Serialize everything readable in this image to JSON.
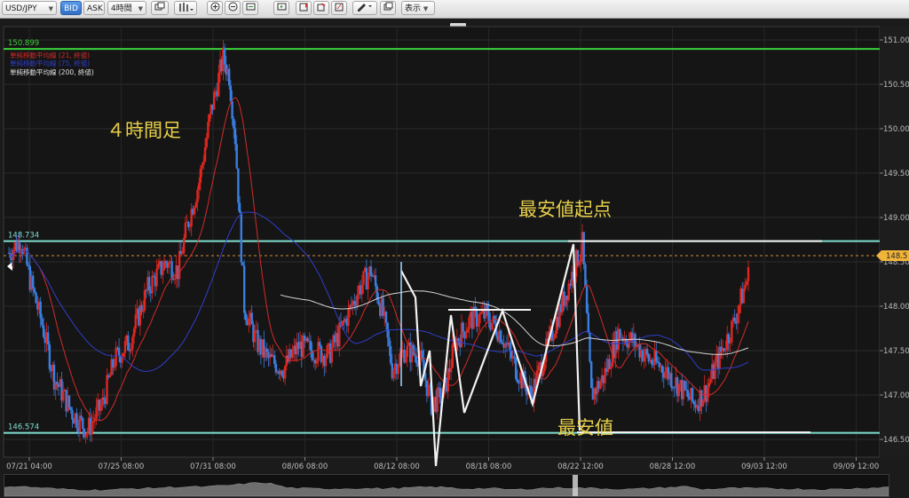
{
  "toolbar": {
    "symbol": "USD/JPY",
    "price_type_bid": "BID",
    "price_type_ask": "ASK",
    "timeframe": "4時間",
    "display_menu": "表示"
  },
  "chart_data": {
    "type": "candlestick",
    "symbol": "USD/JPY",
    "timeframe": "4時間",
    "ylim": [
      146.3,
      151.15
    ],
    "y_ticks": [
      "151.00",
      "150.50",
      "150.00",
      "149.50",
      "149.00",
      "148.50",
      "148.00",
      "147.50",
      "147.00",
      "146.50"
    ],
    "x_ticks": [
      "07/21 04:00",
      "07/25 08:00",
      "07/31 08:00",
      "08/06 08:00",
      "08/12 08:00",
      "08/18 08:00",
      "08/22 12:00",
      "08/28 12:00",
      "09/03 12:00",
      "09/09 12:00"
    ],
    "current_price_label": "148.5",
    "current_price": 148.57,
    "levels": [
      {
        "label": "150.899",
        "value": 150.899,
        "color": "#3bd13b"
      },
      {
        "label": "148.734",
        "value": 148.734,
        "color": "#7fe0d0"
      },
      {
        "label": "146.574",
        "value": 146.574,
        "color": "#7fe0d0"
      }
    ],
    "indicators": [
      {
        "name": "単純移動平均線 (21, 終値)",
        "color": "#d42a2a"
      },
      {
        "name": "単純移動平均線 (75, 終値)",
        "color": "#2f3ec9"
      },
      {
        "name": "単純移動平均線 (200, 終値)",
        "color": "#d6d6d6"
      }
    ],
    "annotations": {
      "timeframe_note": "４時間足",
      "low_start": "最安値起点",
      "low": "最安値"
    },
    "bull_color": "#e0261f",
    "bear_color": "#3a7ee0"
  }
}
